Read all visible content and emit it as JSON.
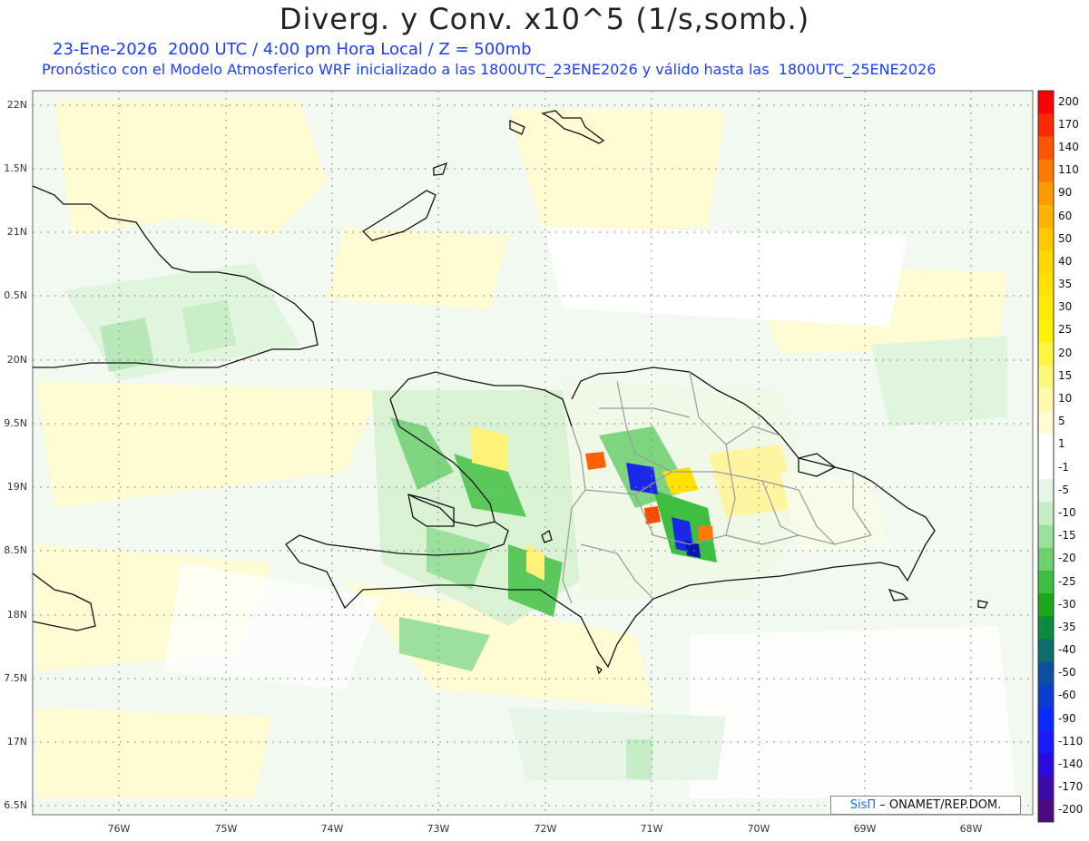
{
  "header": {
    "title": "Diverg. y Conv. x10^5 (1/s,somb.)",
    "line1": "23-Ene-2026  2000 UTC / 4:00 pm Hora Local / Z = 500mb",
    "line2": "Pronóstico con el Modelo Atmosferico WRF inicializado a las 1800UTC_23ENE2026 y válido hasta las  1800UTC_25ENE2026"
  },
  "axes": {
    "lat_labels": [
      "22N",
      "1.5N",
      "21N",
      "0.5N",
      "20N",
      "9.5N",
      "19N",
      "8.5N",
      "18N",
      "7.5N",
      "17N",
      "6.5N"
    ],
    "lon_labels": [
      "76W",
      "75W",
      "74W",
      "73W",
      "72W",
      "71W",
      "70W",
      "69W",
      "68W"
    ]
  },
  "colorbar": {
    "labels": [
      "200",
      "170",
      "140",
      "110",
      "90",
      "60",
      "50",
      "40",
      "35",
      "30",
      "25",
      "20",
      "15",
      "10",
      "5",
      "1",
      "-1",
      "-5",
      "-10",
      "-15",
      "-20",
      "-25",
      "-30",
      "-35",
      "-40",
      "-50",
      "-60",
      "-90",
      "-110",
      "-140",
      "-170",
      "-200"
    ],
    "colors": [
      "#ff0000",
      "#ff2a00",
      "#ff5500",
      "#ff7a00",
      "#ff9a00",
      "#ffb400",
      "#ffc800",
      "#ffd700",
      "#ffe100",
      "#ffea00",
      "#fff000",
      "#fff53c",
      "#fff77a",
      "#fffaaa",
      "#fffcd2",
      "#ffffff",
      "#ffffff",
      "#e6f5e6",
      "#c6edc6",
      "#9be09b",
      "#6fd06f",
      "#3fbf3f",
      "#1aa81a",
      "#0a8a3a",
      "#0a6e6e",
      "#0a4fa0",
      "#0a3ccf",
      "#0a28ff",
      "#1a1aff",
      "#2a0adc",
      "#3c0aaa",
      "#4b0a82"
    ]
  },
  "credit": {
    "brand": "SisΠ",
    "text": "– ONAMET/REP.DOM."
  }
}
